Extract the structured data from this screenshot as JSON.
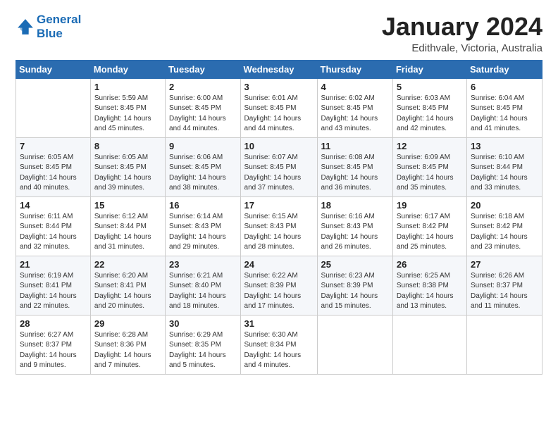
{
  "logo": {
    "line1": "General",
    "line2": "Blue"
  },
  "header": {
    "title": "January 2024",
    "subtitle": "Edithvale, Victoria, Australia"
  },
  "weekdays": [
    "Sunday",
    "Monday",
    "Tuesday",
    "Wednesday",
    "Thursday",
    "Friday",
    "Saturday"
  ],
  "weeks": [
    [
      {
        "day": "",
        "info": ""
      },
      {
        "day": "1",
        "info": "Sunrise: 5:59 AM\nSunset: 8:45 PM\nDaylight: 14 hours\nand 45 minutes."
      },
      {
        "day": "2",
        "info": "Sunrise: 6:00 AM\nSunset: 8:45 PM\nDaylight: 14 hours\nand 44 minutes."
      },
      {
        "day": "3",
        "info": "Sunrise: 6:01 AM\nSunset: 8:45 PM\nDaylight: 14 hours\nand 44 minutes."
      },
      {
        "day": "4",
        "info": "Sunrise: 6:02 AM\nSunset: 8:45 PM\nDaylight: 14 hours\nand 43 minutes."
      },
      {
        "day": "5",
        "info": "Sunrise: 6:03 AM\nSunset: 8:45 PM\nDaylight: 14 hours\nand 42 minutes."
      },
      {
        "day": "6",
        "info": "Sunrise: 6:04 AM\nSunset: 8:45 PM\nDaylight: 14 hours\nand 41 minutes."
      }
    ],
    [
      {
        "day": "7",
        "info": "Sunrise: 6:05 AM\nSunset: 8:45 PM\nDaylight: 14 hours\nand 40 minutes."
      },
      {
        "day": "8",
        "info": "Sunrise: 6:05 AM\nSunset: 8:45 PM\nDaylight: 14 hours\nand 39 minutes."
      },
      {
        "day": "9",
        "info": "Sunrise: 6:06 AM\nSunset: 8:45 PM\nDaylight: 14 hours\nand 38 minutes."
      },
      {
        "day": "10",
        "info": "Sunrise: 6:07 AM\nSunset: 8:45 PM\nDaylight: 14 hours\nand 37 minutes."
      },
      {
        "day": "11",
        "info": "Sunrise: 6:08 AM\nSunset: 8:45 PM\nDaylight: 14 hours\nand 36 minutes."
      },
      {
        "day": "12",
        "info": "Sunrise: 6:09 AM\nSunset: 8:45 PM\nDaylight: 14 hours\nand 35 minutes."
      },
      {
        "day": "13",
        "info": "Sunrise: 6:10 AM\nSunset: 8:44 PM\nDaylight: 14 hours\nand 33 minutes."
      }
    ],
    [
      {
        "day": "14",
        "info": "Sunrise: 6:11 AM\nSunset: 8:44 PM\nDaylight: 14 hours\nand 32 minutes."
      },
      {
        "day": "15",
        "info": "Sunrise: 6:12 AM\nSunset: 8:44 PM\nDaylight: 14 hours\nand 31 minutes."
      },
      {
        "day": "16",
        "info": "Sunrise: 6:14 AM\nSunset: 8:43 PM\nDaylight: 14 hours\nand 29 minutes."
      },
      {
        "day": "17",
        "info": "Sunrise: 6:15 AM\nSunset: 8:43 PM\nDaylight: 14 hours\nand 28 minutes."
      },
      {
        "day": "18",
        "info": "Sunrise: 6:16 AM\nSunset: 8:43 PM\nDaylight: 14 hours\nand 26 minutes."
      },
      {
        "day": "19",
        "info": "Sunrise: 6:17 AM\nSunset: 8:42 PM\nDaylight: 14 hours\nand 25 minutes."
      },
      {
        "day": "20",
        "info": "Sunrise: 6:18 AM\nSunset: 8:42 PM\nDaylight: 14 hours\nand 23 minutes."
      }
    ],
    [
      {
        "day": "21",
        "info": "Sunrise: 6:19 AM\nSunset: 8:41 PM\nDaylight: 14 hours\nand 22 minutes."
      },
      {
        "day": "22",
        "info": "Sunrise: 6:20 AM\nSunset: 8:41 PM\nDaylight: 14 hours\nand 20 minutes."
      },
      {
        "day": "23",
        "info": "Sunrise: 6:21 AM\nSunset: 8:40 PM\nDaylight: 14 hours\nand 18 minutes."
      },
      {
        "day": "24",
        "info": "Sunrise: 6:22 AM\nSunset: 8:39 PM\nDaylight: 14 hours\nand 17 minutes."
      },
      {
        "day": "25",
        "info": "Sunrise: 6:23 AM\nSunset: 8:39 PM\nDaylight: 14 hours\nand 15 minutes."
      },
      {
        "day": "26",
        "info": "Sunrise: 6:25 AM\nSunset: 8:38 PM\nDaylight: 14 hours\nand 13 minutes."
      },
      {
        "day": "27",
        "info": "Sunrise: 6:26 AM\nSunset: 8:37 PM\nDaylight: 14 hours\nand 11 minutes."
      }
    ],
    [
      {
        "day": "28",
        "info": "Sunrise: 6:27 AM\nSunset: 8:37 PM\nDaylight: 14 hours\nand 9 minutes."
      },
      {
        "day": "29",
        "info": "Sunrise: 6:28 AM\nSunset: 8:36 PM\nDaylight: 14 hours\nand 7 minutes."
      },
      {
        "day": "30",
        "info": "Sunrise: 6:29 AM\nSunset: 8:35 PM\nDaylight: 14 hours\nand 5 minutes."
      },
      {
        "day": "31",
        "info": "Sunrise: 6:30 AM\nSunset: 8:34 PM\nDaylight: 14 hours\nand 4 minutes."
      },
      {
        "day": "",
        "info": ""
      },
      {
        "day": "",
        "info": ""
      },
      {
        "day": "",
        "info": ""
      }
    ]
  ]
}
